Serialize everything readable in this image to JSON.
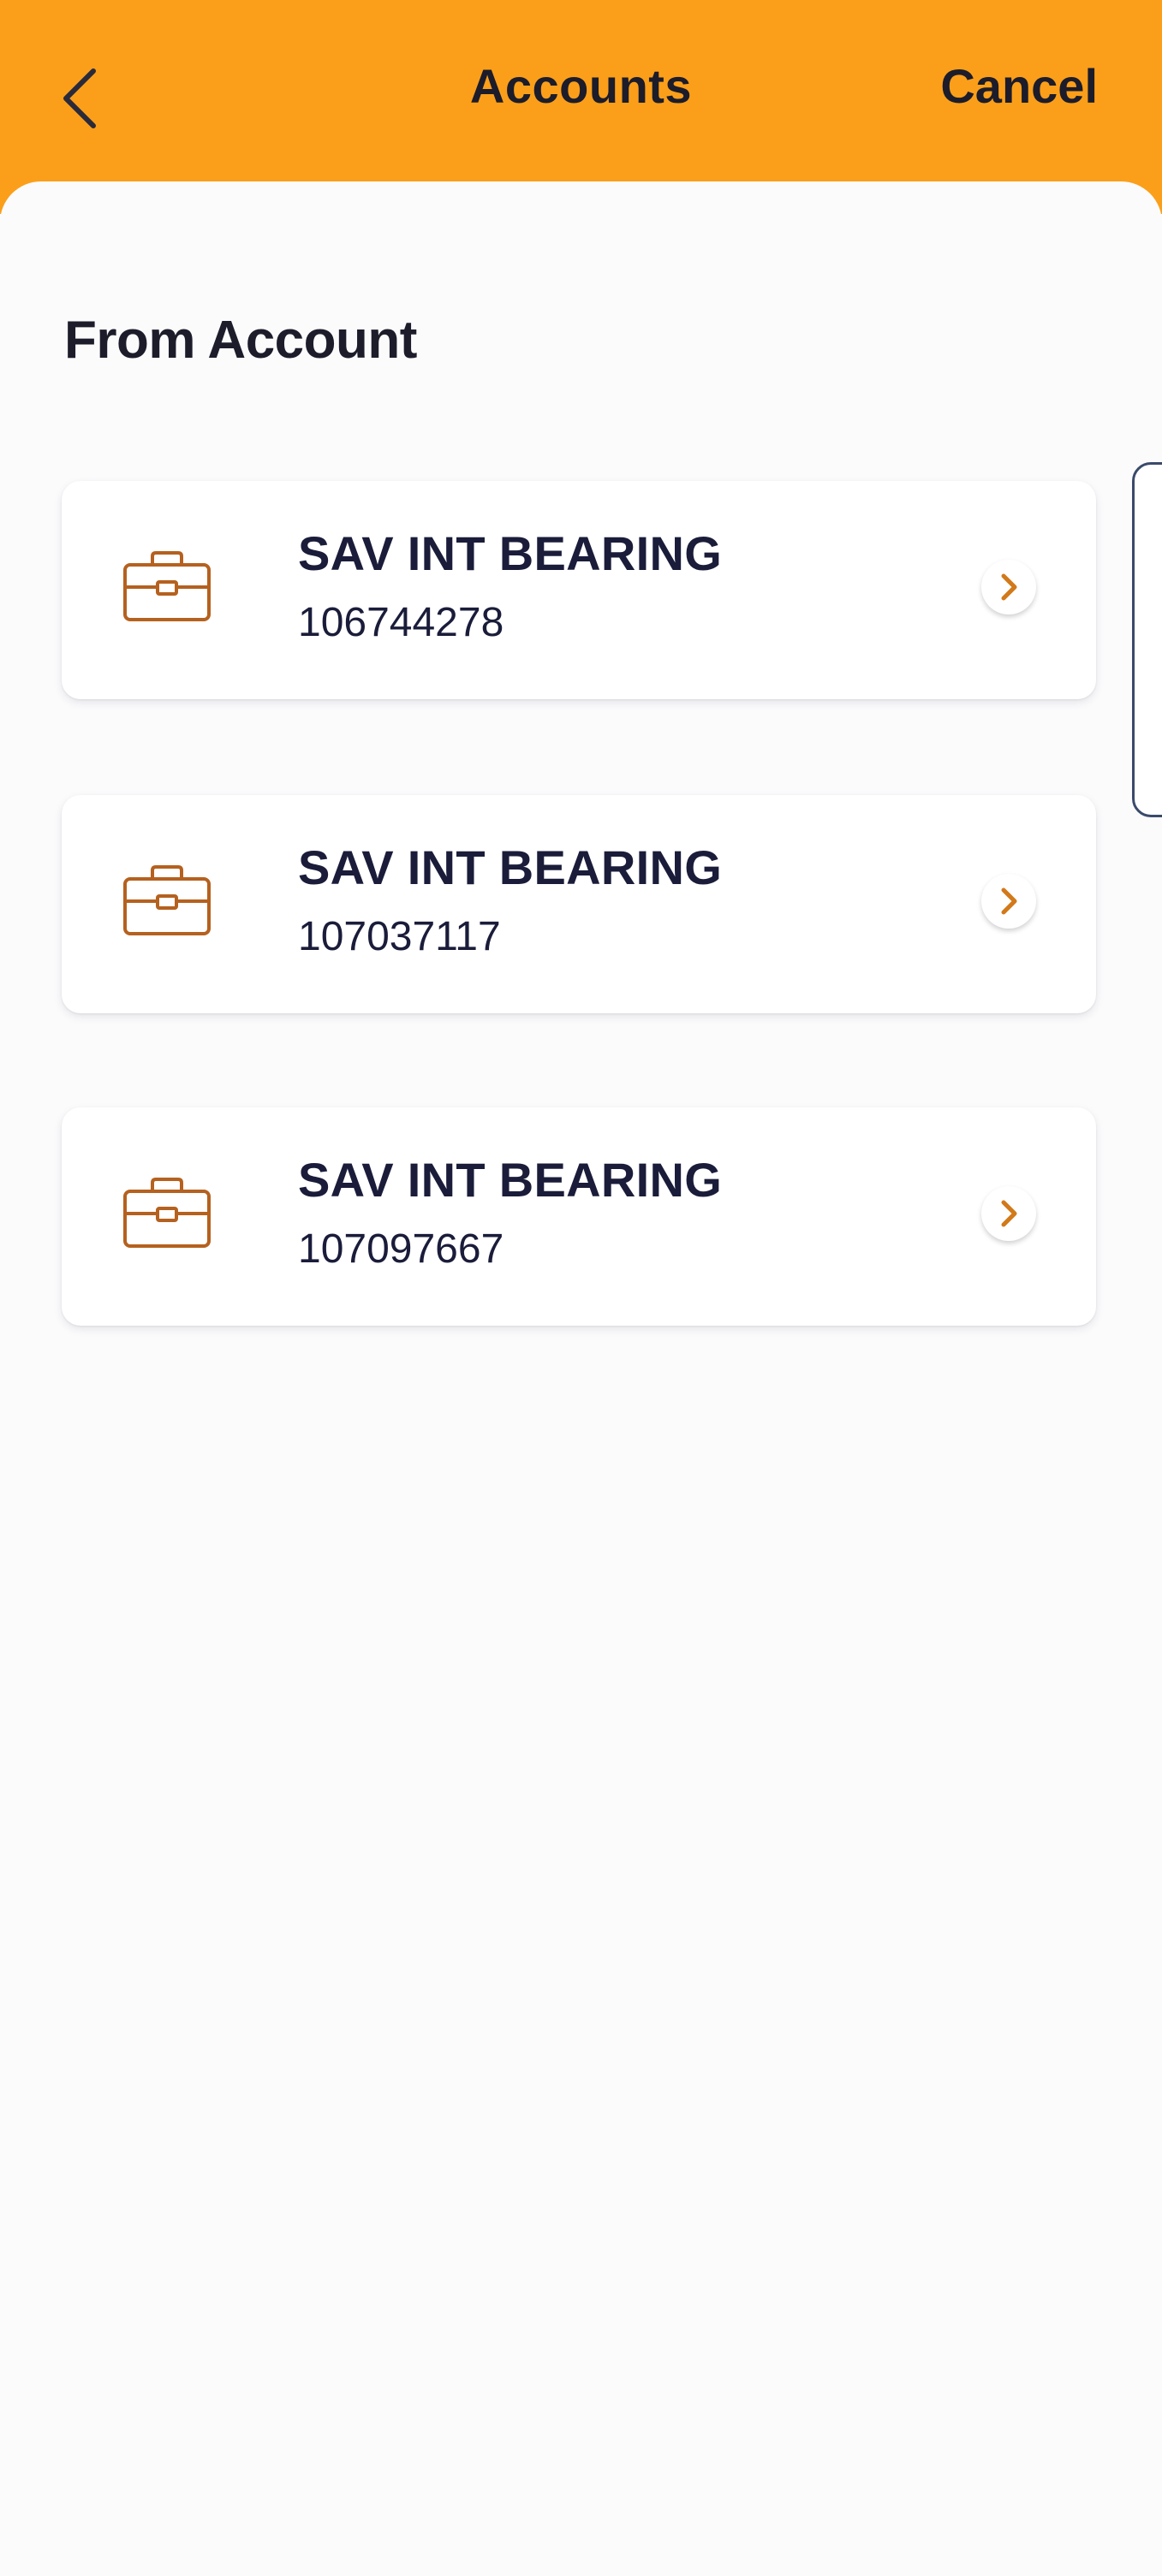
{
  "header": {
    "title": "Accounts",
    "cancel_label": "Cancel",
    "back_icon": "chevron-left-icon",
    "background_color": "#fb9f1a"
  },
  "section": {
    "title": "From Account"
  },
  "accounts": [
    {
      "name": "SAV INT BEARING",
      "number": "106744278",
      "icon": "briefcase-icon"
    },
    {
      "name": "SAV INT BEARING",
      "number": "107037117",
      "icon": "briefcase-icon"
    },
    {
      "name": "SAV INT BEARING",
      "number": "107097667",
      "icon": "briefcase-icon"
    }
  ],
  "colors": {
    "accent": "#fb9f1a",
    "icon": "#b5611f",
    "text": "#1a1c3a"
  }
}
